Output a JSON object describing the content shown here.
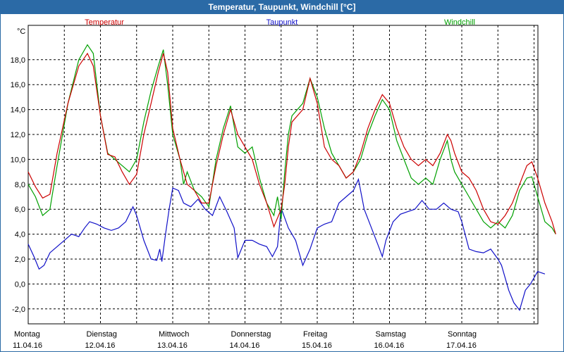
{
  "chart_data": {
    "type": "line",
    "title": "Temperatur, Taupunkt, Windchill [°C]",
    "ylabel": "°C",
    "ylim": [
      -3,
      22
    ],
    "grid": true,
    "y_ticks": [
      "-2,0",
      "0,0",
      "2,0",
      "4,0",
      "6,0",
      "8,0",
      "10,0",
      "12,0",
      "14,0",
      "16,0",
      "18,0"
    ],
    "y_tick_values": [
      -2,
      0,
      2,
      4,
      6,
      8,
      10,
      12,
      14,
      16,
      18
    ],
    "x_day_labels": [
      {
        "day": "Montag",
        "date": "11.04.16",
        "x": 0
      },
      {
        "day": "Dienstag",
        "date": "12.04.16",
        "x": 1
      },
      {
        "day": "Mittwoch",
        "date": "13.04.16",
        "x": 2
      },
      {
        "day": "Donnerstag",
        "date": "14.04.16",
        "x": 3
      },
      {
        "day": "Freitag",
        "date": "15.04.16",
        "x": 4
      },
      {
        "day": "Samstag",
        "date": "16.04.16",
        "x": 5
      },
      {
        "day": "Sonntag",
        "date": "17.04.16",
        "x": 6
      }
    ],
    "x_grid_days": [
      0,
      0.5,
      1,
      1.5,
      2,
      2.5,
      3,
      3.5,
      4,
      4.5,
      5,
      5.5,
      6,
      6.5,
      7
    ],
    "series": [
      {
        "name": "Temperatur",
        "color": "#cc0000",
        "points": [
          [
            0,
            9.0
          ],
          [
            0.1,
            7.8
          ],
          [
            0.2,
            6.9
          ],
          [
            0.3,
            7.2
          ],
          [
            0.4,
            10.5
          ],
          [
            0.55,
            14.5
          ],
          [
            0.7,
            17.5
          ],
          [
            0.82,
            18.5
          ],
          [
            0.9,
            17.5
          ],
          [
            1.0,
            13.5
          ],
          [
            1.1,
            10.4
          ],
          [
            1.2,
            10.2
          ],
          [
            1.3,
            9.0
          ],
          [
            1.4,
            8.0
          ],
          [
            1.5,
            8.8
          ],
          [
            1.6,
            12.0
          ],
          [
            1.7,
            14.5
          ],
          [
            1.8,
            17.0
          ],
          [
            1.87,
            18.5
          ],
          [
            1.93,
            17.0
          ],
          [
            2.0,
            12.5
          ],
          [
            2.1,
            10.0
          ],
          [
            2.2,
            8.0
          ],
          [
            2.3,
            7.5
          ],
          [
            2.4,
            6.5
          ],
          [
            2.5,
            6.5
          ],
          [
            2.6,
            9.5
          ],
          [
            2.7,
            12.0
          ],
          [
            2.8,
            14.0
          ],
          [
            2.9,
            12.0
          ],
          [
            3.0,
            11.0
          ],
          [
            3.1,
            10.0
          ],
          [
            3.2,
            8.0
          ],
          [
            3.3,
            6.5
          ],
          [
            3.4,
            4.6
          ],
          [
            3.5,
            6.0
          ],
          [
            3.55,
            8.0
          ],
          [
            3.6,
            11.0
          ],
          [
            3.65,
            13.0
          ],
          [
            3.8,
            14.0
          ],
          [
            3.9,
            16.5
          ],
          [
            4.0,
            14.5
          ],
          [
            4.1,
            11.0
          ],
          [
            4.2,
            10.0
          ],
          [
            4.3,
            9.5
          ],
          [
            4.4,
            8.5
          ],
          [
            4.5,
            9.0
          ],
          [
            4.6,
            10.5
          ],
          [
            4.7,
            12.5
          ],
          [
            4.8,
            14.0
          ],
          [
            4.9,
            15.2
          ],
          [
            5.0,
            14.5
          ],
          [
            5.1,
            12.5
          ],
          [
            5.2,
            11.0
          ],
          [
            5.3,
            10.0
          ],
          [
            5.4,
            9.5
          ],
          [
            5.5,
            10.0
          ],
          [
            5.6,
            9.5
          ],
          [
            5.7,
            10.5
          ],
          [
            5.8,
            12.0
          ],
          [
            5.85,
            11.5
          ],
          [
            5.9,
            10.5
          ],
          [
            6.0,
            9.0
          ],
          [
            6.1,
            8.5
          ],
          [
            6.2,
            7.5
          ],
          [
            6.3,
            6.0
          ],
          [
            6.4,
            5.0
          ],
          [
            6.5,
            4.8
          ],
          [
            6.6,
            5.5
          ],
          [
            6.7,
            6.5
          ],
          [
            6.8,
            8.0
          ],
          [
            6.9,
            9.5
          ],
          [
            6.97,
            9.8
          ],
          [
            7.05,
            8.5
          ],
          [
            7.15,
            6.5
          ],
          [
            7.25,
            5.0
          ],
          [
            7.3,
            4.0
          ]
        ]
      },
      {
        "name": "Taupunkt",
        "color": "#1010c8",
        "points": [
          [
            0,
            3.2
          ],
          [
            0.08,
            2.2
          ],
          [
            0.15,
            1.2
          ],
          [
            0.22,
            1.5
          ],
          [
            0.3,
            2.5
          ],
          [
            0.4,
            3.0
          ],
          [
            0.5,
            3.5
          ],
          [
            0.6,
            4.0
          ],
          [
            0.7,
            3.8
          ],
          [
            0.78,
            4.5
          ],
          [
            0.85,
            5.0
          ],
          [
            0.95,
            4.8
          ],
          [
            1.05,
            4.5
          ],
          [
            1.15,
            4.3
          ],
          [
            1.25,
            4.5
          ],
          [
            1.35,
            5.0
          ],
          [
            1.45,
            6.2
          ],
          [
            1.5,
            5.5
          ],
          [
            1.6,
            3.5
          ],
          [
            1.7,
            2.0
          ],
          [
            1.78,
            1.9
          ],
          [
            1.82,
            2.8
          ],
          [
            1.85,
            1.8
          ],
          [
            1.9,
            4.0
          ],
          [
            1.95,
            6.0
          ],
          [
            2.0,
            7.7
          ],
          [
            2.08,
            7.5
          ],
          [
            2.15,
            6.5
          ],
          [
            2.25,
            6.2
          ],
          [
            2.35,
            6.8
          ],
          [
            2.45,
            6.0
          ],
          [
            2.55,
            5.5
          ],
          [
            2.65,
            7.0
          ],
          [
            2.75,
            5.8
          ],
          [
            2.85,
            4.5
          ],
          [
            2.9,
            2.1
          ],
          [
            3.0,
            3.5
          ],
          [
            3.1,
            3.5
          ],
          [
            3.2,
            3.2
          ],
          [
            3.3,
            3.0
          ],
          [
            3.38,
            2.2
          ],
          [
            3.45,
            3.0
          ],
          [
            3.5,
            6.1
          ],
          [
            3.6,
            4.5
          ],
          [
            3.7,
            3.5
          ],
          [
            3.8,
            1.5
          ],
          [
            3.9,
            2.8
          ],
          [
            4.0,
            4.5
          ],
          [
            4.1,
            4.8
          ],
          [
            4.2,
            5.0
          ],
          [
            4.3,
            6.5
          ],
          [
            4.4,
            7.0
          ],
          [
            4.5,
            7.5
          ],
          [
            4.57,
            8.4
          ],
          [
            4.65,
            6.0
          ],
          [
            4.75,
            4.5
          ],
          [
            4.85,
            3.0
          ],
          [
            4.9,
            2.2
          ],
          [
            4.95,
            3.5
          ],
          [
            5.05,
            5.0
          ],
          [
            5.15,
            5.6
          ],
          [
            5.25,
            5.8
          ],
          [
            5.35,
            6.0
          ],
          [
            5.45,
            6.7
          ],
          [
            5.55,
            6.0
          ],
          [
            5.65,
            6.0
          ],
          [
            5.75,
            6.5
          ],
          [
            5.85,
            6.0
          ],
          [
            5.95,
            5.8
          ],
          [
            6.0,
            5.0
          ],
          [
            6.1,
            2.8
          ],
          [
            6.2,
            2.6
          ],
          [
            6.3,
            2.5
          ],
          [
            6.4,
            2.8
          ],
          [
            6.5,
            2.0
          ],
          [
            6.55,
            1.5
          ],
          [
            6.65,
            -0.5
          ],
          [
            6.72,
            -1.5
          ],
          [
            6.8,
            -2.1
          ],
          [
            6.88,
            -0.5
          ],
          [
            6.95,
            0.0
          ],
          [
            7.05,
            1.0
          ],
          [
            7.15,
            0.8
          ]
        ]
      },
      {
        "name": "Windchill",
        "color": "#00a000",
        "points": [
          [
            0,
            8.0
          ],
          [
            0.1,
            7.0
          ],
          [
            0.2,
            5.5
          ],
          [
            0.3,
            6.0
          ],
          [
            0.4,
            9.5
          ],
          [
            0.55,
            14.5
          ],
          [
            0.7,
            18.0
          ],
          [
            0.82,
            19.2
          ],
          [
            0.9,
            18.5
          ],
          [
            1.0,
            13.5
          ],
          [
            1.1,
            10.5
          ],
          [
            1.2,
            10.0
          ],
          [
            1.3,
            9.5
          ],
          [
            1.4,
            9.0
          ],
          [
            1.5,
            10.0
          ],
          [
            1.6,
            13.0
          ],
          [
            1.7,
            15.5
          ],
          [
            1.8,
            17.5
          ],
          [
            1.87,
            18.8
          ],
          [
            1.93,
            16.0
          ],
          [
            2.0,
            12.0
          ],
          [
            2.1,
            10.0
          ],
          [
            2.15,
            8.0
          ],
          [
            2.2,
            9.0
          ],
          [
            2.3,
            7.5
          ],
          [
            2.4,
            7.0
          ],
          [
            2.5,
            6.2
          ],
          [
            2.6,
            10.0
          ],
          [
            2.7,
            12.5
          ],
          [
            2.8,
            14.3
          ],
          [
            2.9,
            11.0
          ],
          [
            3.0,
            10.5
          ],
          [
            3.1,
            11.0
          ],
          [
            3.2,
            8.5
          ],
          [
            3.3,
            6.5
          ],
          [
            3.4,
            5.5
          ],
          [
            3.45,
            7.0
          ],
          [
            3.5,
            5.2
          ],
          [
            3.55,
            9.0
          ],
          [
            3.6,
            12.0
          ],
          [
            3.65,
            13.5
          ],
          [
            3.8,
            14.5
          ],
          [
            3.9,
            16.5
          ],
          [
            4.0,
            15.0
          ],
          [
            4.1,
            12.5
          ],
          [
            4.2,
            10.5
          ],
          [
            4.3,
            9.5
          ],
          [
            4.4,
            8.5
          ],
          [
            4.5,
            9.0
          ],
          [
            4.6,
            10.0
          ],
          [
            4.7,
            12.0
          ],
          [
            4.8,
            13.5
          ],
          [
            4.9,
            14.8
          ],
          [
            5.0,
            14.0
          ],
          [
            5.1,
            11.5
          ],
          [
            5.2,
            10.0
          ],
          [
            5.3,
            8.5
          ],
          [
            5.4,
            8.0
          ],
          [
            5.5,
            8.5
          ],
          [
            5.6,
            8.0
          ],
          [
            5.7,
            10.0
          ],
          [
            5.8,
            11.5
          ],
          [
            5.85,
            10.0
          ],
          [
            5.9,
            9.0
          ],
          [
            6.0,
            8.0
          ],
          [
            6.1,
            7.0
          ],
          [
            6.2,
            6.0
          ],
          [
            6.3,
            5.0
          ],
          [
            6.4,
            4.5
          ],
          [
            6.5,
            5.0
          ],
          [
            6.6,
            4.5
          ],
          [
            6.7,
            5.5
          ],
          [
            6.8,
            7.5
          ],
          [
            6.9,
            8.5
          ],
          [
            6.97,
            8.6
          ],
          [
            7.05,
            7.0
          ],
          [
            7.15,
            5.0
          ],
          [
            7.25,
            4.5
          ],
          [
            7.3,
            4.0
          ]
        ]
      }
    ]
  }
}
